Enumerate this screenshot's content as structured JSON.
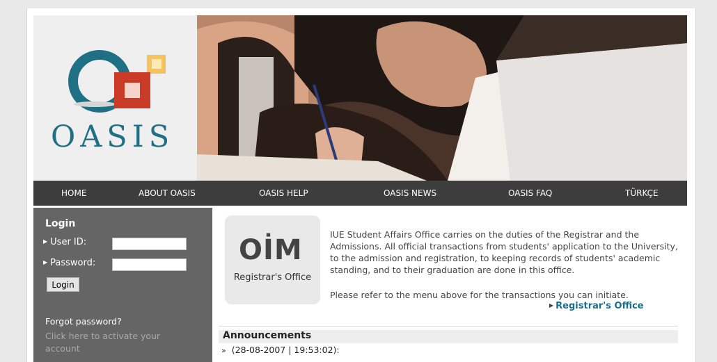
{
  "logo": {
    "text": "OASIS"
  },
  "nav": {
    "items": [
      "HOME",
      "ABOUT OASIS",
      "OASIS HELP",
      "OASIS NEWS",
      "OASIS FAQ",
      "TÜRKÇE"
    ]
  },
  "login": {
    "title": "Login",
    "user_label": "User ID:",
    "password_label": "Password:",
    "user_value": "",
    "password_value": "",
    "button": "Login",
    "forgot": "Forgot password?",
    "activate": "Click here to activate your account"
  },
  "registrar": {
    "logo_main": "OİM",
    "logo_sub": "Registrar's Office",
    "description": "IUE Student Affairs Office carries on the duties of the Registrar and the Admissions. All official transactions from students' application to the University, to the admission and registration, to keeping records of students' academic standing, and to their graduation are done in this office.",
    "refer": "Please refer to the menu above for the transactions you can initiate.",
    "link": "Registrar's Office"
  },
  "announcements": {
    "title": "Announcements",
    "items": [
      "(28-08-2007 | 19:53:02):"
    ]
  },
  "colors": {
    "nav_bg": "#3d3d3d",
    "sidebar_bg": "#656565",
    "link": "#1a6e8e",
    "logo_teal": "#1f6f85",
    "logo_red": "#c0392b",
    "logo_gold": "#f2b84b"
  }
}
